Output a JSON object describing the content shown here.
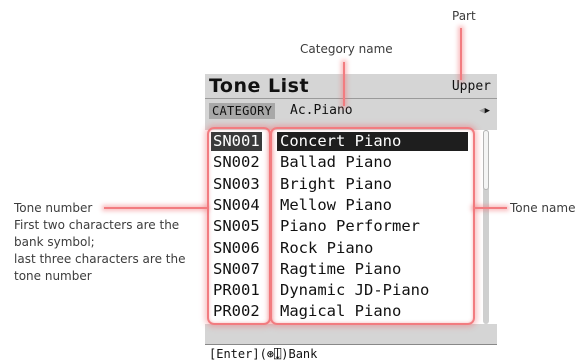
{
  "annotations": {
    "part": "Part",
    "category_name": "Category name",
    "tone_name": "Tone name",
    "tone_number_lines": [
      "Tone number",
      "First two characters are the",
      "bank symbol;",
      "last three characters are the",
      "tone number"
    ]
  },
  "screen": {
    "title": "Tone List",
    "part_value": "Upper",
    "category_label": "CATEGORY",
    "category_value": "Ac.Piano",
    "footer": "[Enter](⊛⍗)Bank",
    "selected_index": 0,
    "tones": [
      {
        "number": "SN001",
        "name": "Concert Piano"
      },
      {
        "number": "SN002",
        "name": "Ballad Piano"
      },
      {
        "number": "SN003",
        "name": "Bright Piano"
      },
      {
        "number": "SN004",
        "name": "Mellow Piano"
      },
      {
        "number": "SN005",
        "name": "Piano Performer"
      },
      {
        "number": "SN006",
        "name": "Rock Piano"
      },
      {
        "number": "SN007",
        "name": "Ragtime Piano"
      },
      {
        "number": "PR001",
        "name": "Dynamic JD-Piano"
      },
      {
        "number": "PR002",
        "name": "Magical Piano"
      }
    ]
  },
  "colors": {
    "highlight": "#f27c80",
    "screen_bg": "#d5d5d5",
    "selection": "#1e1e1e"
  }
}
